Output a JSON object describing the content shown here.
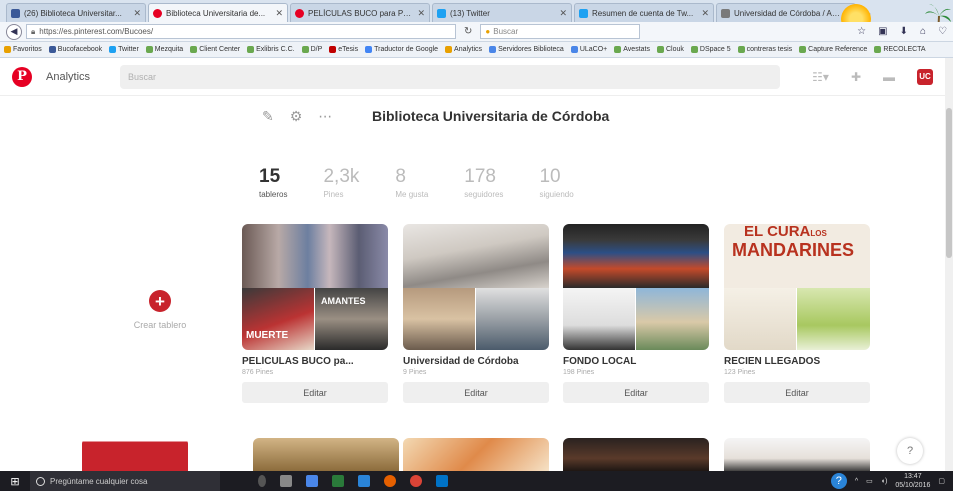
{
  "browser": {
    "tabs": [
      {
        "label": "(26) Biblioteca Universitar...",
        "color": "#3b5998",
        "active": false
      },
      {
        "label": "Biblioteca Universitaria de...",
        "color": "#e60023",
        "active": true
      },
      {
        "label": "PELÍCULAS BUCO para PR...",
        "color": "#e60023",
        "active": false
      },
      {
        "label": "(13) Twitter",
        "color": "#1da1f2",
        "active": false
      },
      {
        "label": "Resumen de cuenta de Tw...",
        "color": "#1da1f2",
        "active": false
      },
      {
        "label": "Universidad de Córdoba / All L...",
        "color": "#7a7a7a",
        "active": false
      }
    ],
    "url": "https://es.pinterest.com/Bucoes/",
    "search_placeholder": "Buscar",
    "bookmarks": [
      {
        "label": "Favoritos",
        "color": "#e8a000"
      },
      {
        "label": "Bucofacebook",
        "color": "#3b5998"
      },
      {
        "label": "Twitter",
        "color": "#1da1f2"
      },
      {
        "label": "Mezquita",
        "color": "#6aa84f"
      },
      {
        "label": "Client Center",
        "color": "#6aa84f"
      },
      {
        "label": "Exlibris C.C.",
        "color": "#6aa84f"
      },
      {
        "label": "D/P",
        "color": "#6aa84f"
      },
      {
        "label": "eTesis",
        "color": "#c00000"
      },
      {
        "label": "Traductor de Google",
        "color": "#4285f4"
      },
      {
        "label": "Analytics",
        "color": "#e8a000"
      },
      {
        "label": "Servidores Biblioteca",
        "color": "#4a86e8"
      },
      {
        "label": "ULaCO+",
        "color": "#4a86e8"
      },
      {
        "label": "Avestats",
        "color": "#6aa84f"
      },
      {
        "label": "Clouk",
        "color": "#6aa84f"
      },
      {
        "label": "DSpace 5",
        "color": "#6aa84f"
      },
      {
        "label": "contreras tesis",
        "color": "#6aa84f"
      },
      {
        "label": "Capture Reference",
        "color": "#6aa84f"
      },
      {
        "label": "RECOLECTA",
        "color": "#6aa84f"
      }
    ]
  },
  "header": {
    "logo": "P",
    "analytics": "Analytics",
    "search_placeholder": "Buscar"
  },
  "profile": {
    "name": "Biblioteca Universitaria de Córdoba",
    "stats": [
      {
        "num": "15",
        "label": "tableros",
        "active": true
      },
      {
        "num": "2,3k",
        "label": "Pines",
        "active": false
      },
      {
        "num": "8",
        "label": "Me gusta",
        "active": false
      },
      {
        "num": "178",
        "label": "seguidores",
        "active": false
      },
      {
        "num": "10",
        "label": "siguiendo",
        "active": false
      }
    ]
  },
  "create_board": {
    "label": "Crear tablero"
  },
  "boards": [
    {
      "title": "PELÍCULAS BUCO pa...",
      "pins": "876 Pines",
      "edit": "Editar"
    },
    {
      "title": "Universidad de Córdoba",
      "pins": "9 Pines",
      "edit": "Editar"
    },
    {
      "title": "FONDO LOCAL",
      "pins": "198 Pines",
      "edit": "Editar"
    },
    {
      "title": "RECIEN LLEGADOS",
      "pins": "123 Pines",
      "edit": "Editar"
    }
  ],
  "board_cover_text": {
    "mandarines_l1": "EL CURA",
    "mandarines_small": "LOS",
    "mandarines_l2": "MANDARINES",
    "amantes": "AMANTES",
    "muerte": "MUERTE"
  },
  "help": "?",
  "taskbar": {
    "search": "Pregúntame cualquier cosa",
    "time": "13:47",
    "date": "05/10/2016"
  }
}
